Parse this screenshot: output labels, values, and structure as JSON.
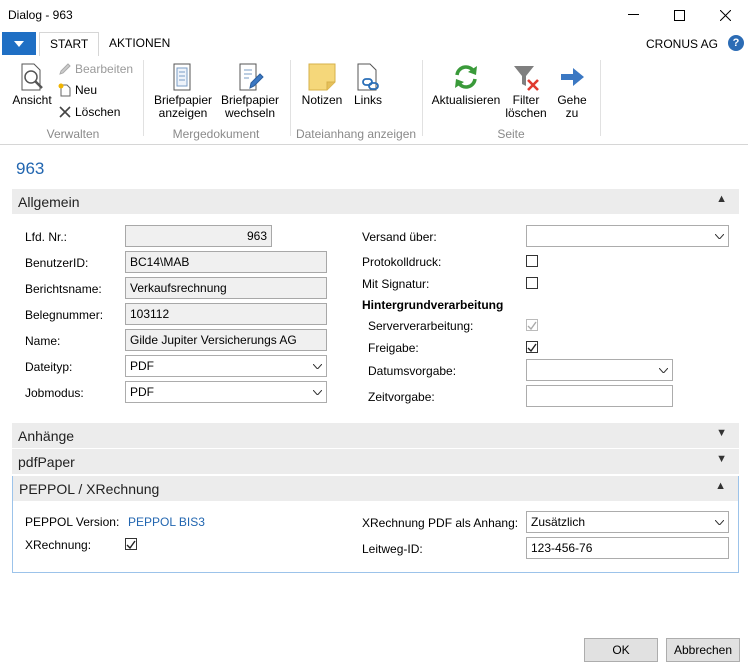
{
  "window": {
    "title": "Dialog - 963",
    "minimize": "—",
    "maximize": "☐",
    "close": "✕"
  },
  "tabs": {
    "start": "START",
    "aktionen": "AKTIONEN"
  },
  "company": "CRONUS AG",
  "help": "?",
  "ribbon": {
    "verwalten": {
      "ansicht": "Ansicht",
      "bearbeiten": "Bearbeiten",
      "neu": "Neu",
      "loeschen": "Löschen",
      "label": "Verwalten"
    },
    "mergedokument": {
      "briefpapier_anzeigen": [
        "Briefpapier",
        "anzeigen"
      ],
      "briefpapier_wechseln": [
        "Briefpapier",
        "wechseln"
      ],
      "label": "Mergedokument"
    },
    "dateianhang": {
      "notizen": "Notizen",
      "links": "Links",
      "label": "Dateianhang anzeigen"
    },
    "seite": {
      "aktualisieren": "Aktualisieren",
      "filter_loeschen": [
        "Filter",
        "löschen"
      ],
      "gehe_zu": [
        "Gehe",
        "zu"
      ],
      "label": "Seite"
    }
  },
  "record": {
    "id": "963"
  },
  "allgemein": {
    "title": "Allgemein",
    "lfd_nr": {
      "label": "Lfd. Nr.:",
      "value": "963"
    },
    "benutzerid": {
      "label": "BenutzerID:",
      "value": "BC14\\MAB"
    },
    "berichtsname": {
      "label": "Berichtsname:",
      "value": "Verkaufsrechnung"
    },
    "belegnummer": {
      "label": "Belegnummer:",
      "value": "103112"
    },
    "name": {
      "label": "Name:",
      "value": "Gilde Jupiter Versicherungs AG"
    },
    "dateityp": {
      "label": "Dateityp:",
      "value": "PDF"
    },
    "jobmodus": {
      "label": "Jobmodus:",
      "value": "PDF"
    },
    "versand_ueber": {
      "label": "Versand über:",
      "value": ""
    },
    "protokolldruck": {
      "label": "Protokolldruck:",
      "checked": false
    },
    "mit_signatur": {
      "label": "Mit Signatur:",
      "checked": false
    },
    "hintergrund": "Hintergrundverarbeitung",
    "serververarbeitung": {
      "label": "Serververarbeitung:",
      "checked": true,
      "disabled": true
    },
    "freigabe": {
      "label": "Freigabe:",
      "checked": true
    },
    "datumsvorgabe": {
      "label": "Datumsvorgabe:",
      "value": ""
    },
    "zeitvorgabe": {
      "label": "Zeitvorgabe:",
      "value": ""
    }
  },
  "anhaenge": {
    "title": "Anhänge"
  },
  "pdfpaper": {
    "title": "pdfPaper"
  },
  "peppol": {
    "title": "PEPPOL / XRechnung",
    "version": {
      "label": "PEPPOL Version:",
      "value": "PEPPOL BIS3"
    },
    "xrechnung": {
      "label": "XRechnung:",
      "checked": true
    },
    "pdf_anhang": {
      "label": "XRechnung PDF als Anhang:",
      "value": "Zusätzlich"
    },
    "leitweg": {
      "label": "Leitweg-ID:",
      "value": "123-456-76"
    }
  },
  "buttons": {
    "ok": "OK",
    "abbrechen": "Abbrechen"
  },
  "icons": {
    "chevron_up": "▲",
    "chevron_down": "▼",
    "dropdown_arrow": "⌵",
    "check": "✓"
  }
}
